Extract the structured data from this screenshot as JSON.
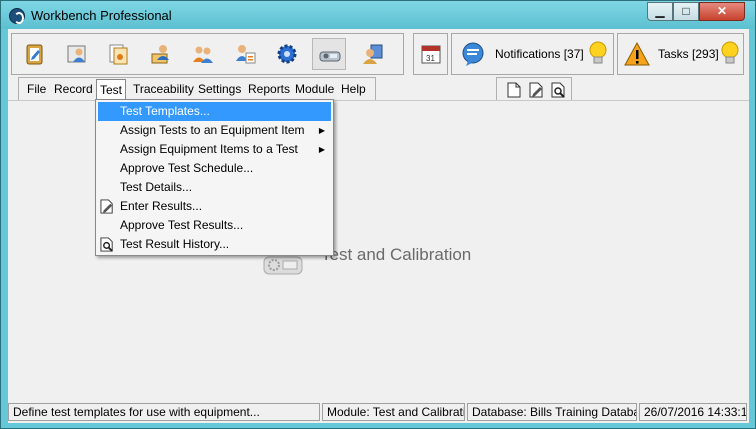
{
  "window": {
    "title": "Workbench Professional"
  },
  "notifications": {
    "label": "Notifications [37]"
  },
  "tasks": {
    "label": "Tasks [293]"
  },
  "toolbar": {
    "icons": [
      "clipboard-icon",
      "user-card-icon",
      "documents-icon",
      "person-certificate-icon",
      "group-icon",
      "user-list-icon",
      "gear-icon",
      "calibration-device-icon",
      "user-key-icon",
      "calendar-icon"
    ]
  },
  "menubar": {
    "items": [
      "File",
      "Record",
      "Test",
      "Traceability",
      "Settings",
      "Reports",
      "Module",
      "Help"
    ]
  },
  "test_menu": {
    "items": [
      {
        "label": "Test Templates...",
        "highlighted": true,
        "submenu": false
      },
      {
        "label": "Assign Tests to an Equipment Item",
        "submenu": true
      },
      {
        "label": "Assign Equipment Items to a Test",
        "submenu": true
      },
      {
        "label": "Approve Test Schedule...",
        "submenu": false
      },
      {
        "label": "Test Details...",
        "submenu": false
      },
      {
        "label": "Enter Results...",
        "submenu": false,
        "icon": "edit-document-icon"
      },
      {
        "label": "Approve Test Results...",
        "submenu": false
      },
      {
        "label": "Test Result History...",
        "submenu": false,
        "icon": "search-document-icon"
      }
    ]
  },
  "main": {
    "module_title": "Test and Calibration"
  },
  "statusbar": {
    "hint": "Define test templates for use with equipment...",
    "module": "Module: Test and Calibration",
    "database": "Database: Bills Training Database",
    "datetime": "26/07/2016 14:33:19"
  },
  "colors": {
    "title_bar": "#64c8d8",
    "highlight": "#3399ff",
    "close_button": "#c8412c"
  }
}
